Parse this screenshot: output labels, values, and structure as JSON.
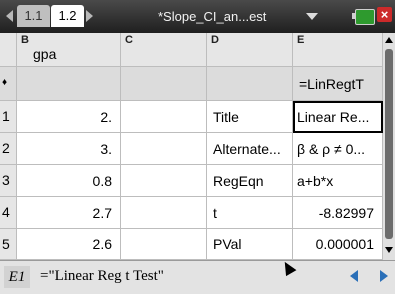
{
  "tabs": [
    {
      "label": "1.1"
    },
    {
      "label": "1.2"
    }
  ],
  "document_title": "*Slope_CI_an...est",
  "colors": {
    "topbar": "#2a2a2a",
    "active_tab": "#ffffff",
    "selection": "#000000",
    "nav_arrow": "#2a6fb8",
    "battery": "#2e9a2e",
    "close": "#cc2a2a"
  },
  "icons": {
    "prev_page": "triangle-left",
    "next_page": "triangle-right",
    "doc_menu": "chevron-down",
    "battery": "battery-icon",
    "close": "close-icon"
  },
  "columns": [
    {
      "letter": "B",
      "name": "gpa"
    },
    {
      "letter": "C",
      "name": ""
    },
    {
      "letter": "D",
      "name": ""
    },
    {
      "letter": "E",
      "name": ""
    }
  ],
  "formula_row": {
    "marker": "♦",
    "e_formula": "=LinRegtT"
  },
  "rows": [
    {
      "num": "1",
      "b": "2.",
      "d": "Title",
      "e": "Linear Re..."
    },
    {
      "num": "2",
      "b": "3.",
      "d": "Alternate...",
      "e": "β & ρ ≠ 0..."
    },
    {
      "num": "3",
      "b": "0.8",
      "d": "RegEqn",
      "e": "a+b*x"
    },
    {
      "num": "4",
      "b": "2.7",
      "d": "t",
      "e": "-8.82997"
    },
    {
      "num": "5",
      "b": "2.6",
      "d": "PVal",
      "e": "0.000001"
    }
  ],
  "entry_bar": {
    "cell_ref": "E1",
    "content": "=\"Linear Reg t Test\""
  }
}
